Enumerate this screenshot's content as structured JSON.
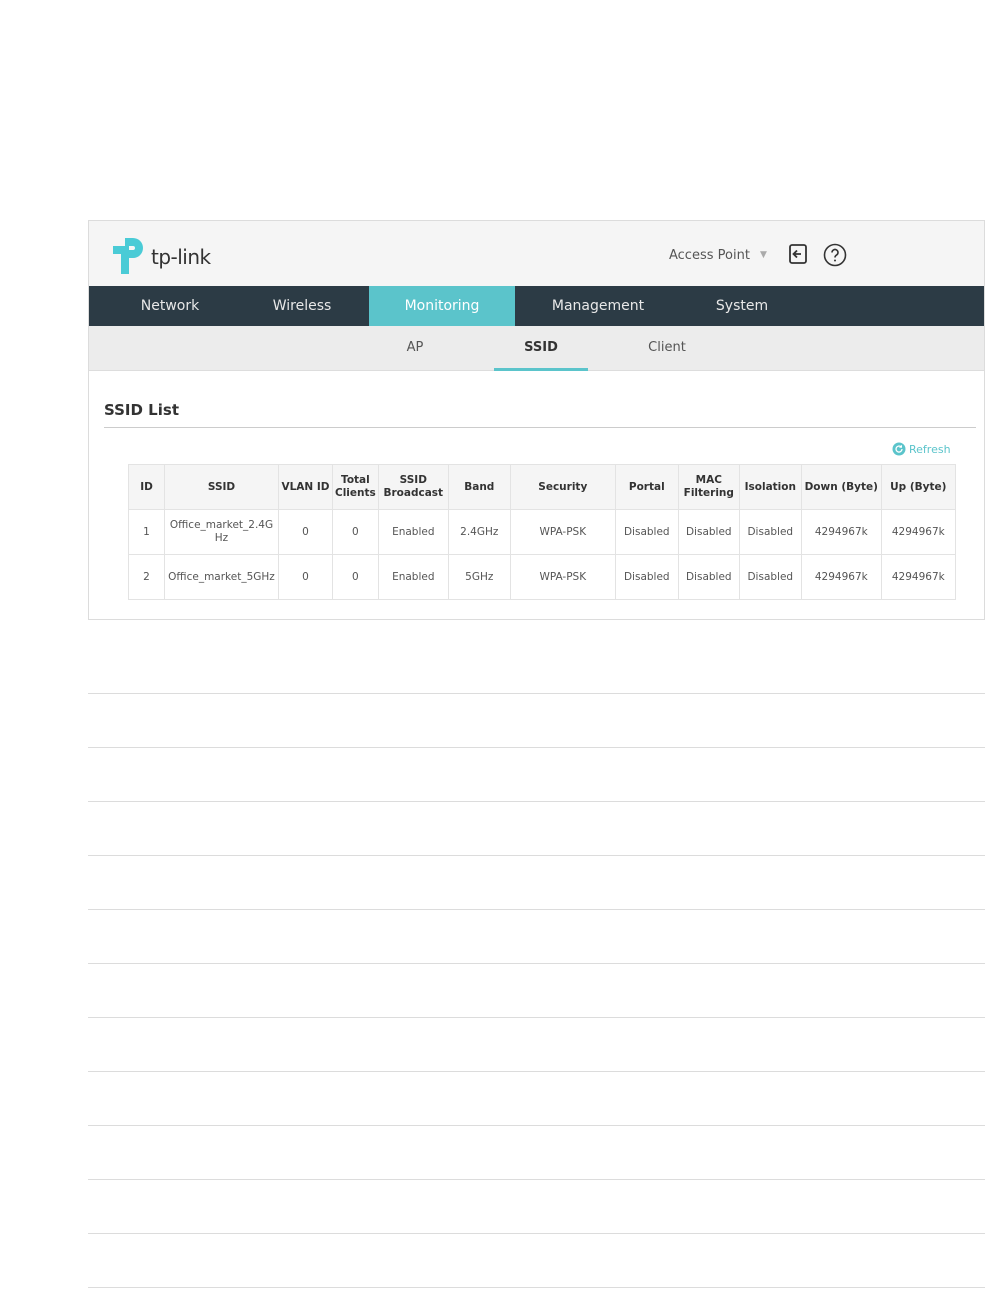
{
  "header": {
    "brand": "tp-link",
    "mode_selector": "Access Point"
  },
  "nav": {
    "items": [
      {
        "label": "Network"
      },
      {
        "label": "Wireless"
      },
      {
        "label": "Monitoring",
        "active": true
      },
      {
        "label": "Management"
      },
      {
        "label": "System"
      }
    ]
  },
  "subnav": {
    "items": [
      {
        "label": "AP"
      },
      {
        "label": "SSID",
        "active": true
      },
      {
        "label": "Client"
      }
    ]
  },
  "ssid_list": {
    "title": "SSID List",
    "refresh_label": "Refresh",
    "columns": [
      "ID",
      "SSID",
      "VLAN ID",
      "Total Clients",
      "SSID Broadcast",
      "Band",
      "Security",
      "Portal",
      "MAC Filtering",
      "Isolation",
      "Down (Byte)",
      "Up (Byte)"
    ],
    "rows": [
      [
        "1",
        "Office_market_2.4GHz",
        "0",
        "0",
        "Enabled",
        "2.4GHz",
        "WPA-PSK",
        "Disabled",
        "Disabled",
        "Disabled",
        "4294967k",
        "4294967k"
      ],
      [
        "2",
        "Office_market_5GHz",
        "0",
        "0",
        "Enabled",
        "5GHz",
        "WPA-PSK",
        "Disabled",
        "Disabled",
        "Disabled",
        "4294967k",
        "4294967k"
      ]
    ]
  },
  "colors": {
    "accent": "#5bc4cb",
    "nav_bg": "#2c3b45",
    "subnav_bg": "#ececec",
    "topbar_bg": "#f5f5f5"
  },
  "icons": [
    "tp-link-logo-icon",
    "logout-icon",
    "help-icon",
    "caret-down-icon",
    "refresh-icon"
  ]
}
